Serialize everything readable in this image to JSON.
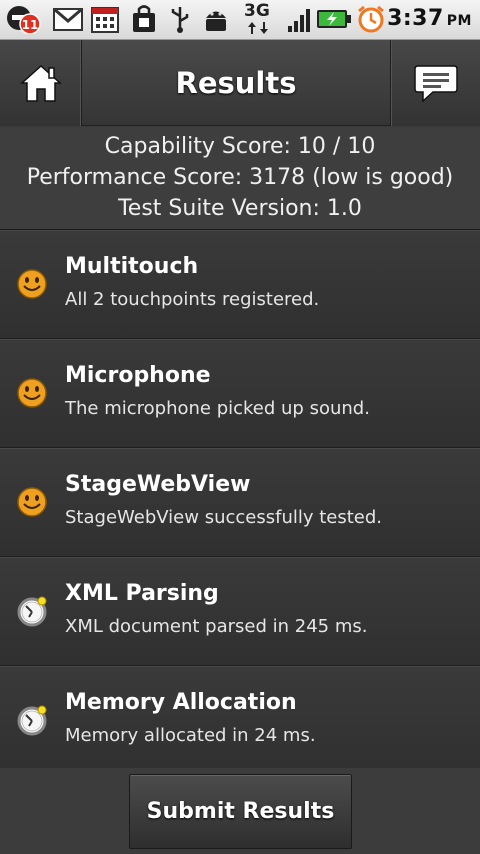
{
  "status_bar": {
    "notification_count": "11",
    "network": "3G",
    "time": "3:37",
    "ampm": "PM"
  },
  "action_bar": {
    "title": "Results"
  },
  "scores": {
    "capability": "Capability Score: 10 / 10",
    "performance": "Performance Score: 3178 (low is good)",
    "suite_version": "Test Suite Version: 1.0"
  },
  "results": [
    {
      "title": "Multitouch",
      "description": "All 2 touchpoints registered.",
      "icon": "smiley-icon"
    },
    {
      "title": "Microphone",
      "description": "The microphone picked up sound.",
      "icon": "smiley-icon"
    },
    {
      "title": "StageWebView",
      "description": "StageWebView successfully tested.",
      "icon": "smiley-icon"
    },
    {
      "title": "XML Parsing",
      "description": "XML document parsed in 245 ms.",
      "icon": "stopwatch-icon"
    },
    {
      "title": "Memory Allocation",
      "description": "Memory allocated in 24 ms.",
      "icon": "stopwatch-icon"
    }
  ],
  "footer": {
    "submit_label": "Submit Results"
  },
  "colors": {
    "smiley": "#f0a020",
    "battery": "#3cb83c",
    "alarm": "#f07820",
    "badge": "#e03020"
  }
}
